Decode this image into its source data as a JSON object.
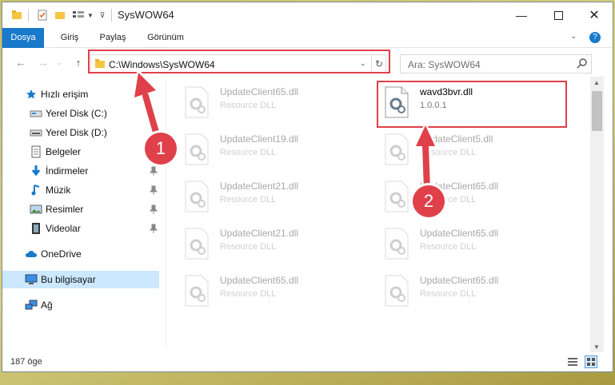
{
  "window": {
    "title": "SysWOW64"
  },
  "ribbon": {
    "tabs": [
      "Dosya",
      "Giriş",
      "Paylaş",
      "Görünüm"
    ]
  },
  "address": {
    "path": "C:\\Windows\\SysWOW64"
  },
  "search": {
    "placeholder": "Ara: SysWOW64"
  },
  "nav": {
    "items": [
      {
        "label": "Hızlı erişim",
        "icon": "star-icon"
      },
      {
        "label": "Yerel Disk (C:)",
        "icon": "drive-icon"
      },
      {
        "label": "Yerel Disk (D:)",
        "icon": "drive-icon"
      },
      {
        "label": "Belgeler",
        "icon": "documents-icon"
      },
      {
        "label": "İndirmeler",
        "icon": "download-icon"
      },
      {
        "label": "Müzik",
        "icon": "music-icon"
      },
      {
        "label": "Resimler",
        "icon": "pictures-icon"
      },
      {
        "label": "Videolar",
        "icon": "video-icon"
      },
      {
        "label": "OneDrive",
        "icon": "cloud-icon"
      },
      {
        "label": "Bu bilgisayar",
        "icon": "computer-icon"
      },
      {
        "label": "Ağ",
        "icon": "network-icon"
      }
    ]
  },
  "files": [
    {
      "name": "UpdateClient65.dll",
      "sub": "Resource DLL"
    },
    {
      "name": "wavd3bvr.dll",
      "sub": "1.0.0.1"
    },
    {
      "name": "UpdateClient19.dll",
      "sub": "Resource DLL"
    },
    {
      "name": "UpdateClient5.dll",
      "sub": "Resource DLL"
    },
    {
      "name": "UpdateClient21.dll",
      "sub": "Resource DLL"
    },
    {
      "name": "UpdateClient65.dll",
      "sub": "Resource DLL"
    },
    {
      "name": "UpdateClient21.dll",
      "sub": "Resource DLL"
    },
    {
      "name": "UpdateClient65.dll",
      "sub": "Resource DLL"
    },
    {
      "name": "UpdateClient65.dll",
      "sub": "Resource DLL"
    },
    {
      "name": "UpdateClient65.dll",
      "sub": "Resource DLL"
    }
  ],
  "status": {
    "count": "187 öge"
  },
  "annotations": {
    "step1": "1",
    "step2": "2"
  },
  "colors": {
    "accent": "#1979ca",
    "highlight": "#e0404a",
    "selected": "#cce8ff"
  }
}
